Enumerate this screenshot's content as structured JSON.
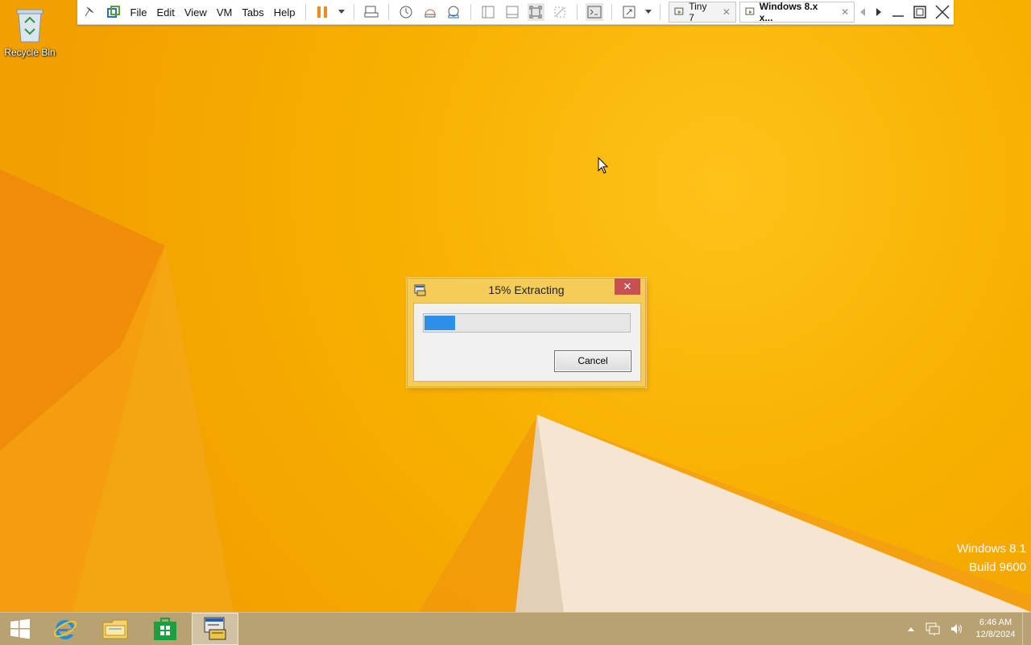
{
  "desktop": {
    "recycle_bin_label": "Recycle Bin",
    "watermark_line1": "Windows 8.1",
    "watermark_line2": "Build 9600"
  },
  "vm_toolbar": {
    "menus": [
      "File",
      "Edit",
      "View",
      "VM",
      "Tabs",
      "Help"
    ],
    "tabs": [
      {
        "label": "Tiny 7",
        "active": false
      },
      {
        "label": "Windows 8.x x...",
        "active": true
      }
    ]
  },
  "dialog": {
    "title": "15% Extracting",
    "progress_fraction": 0.15,
    "cancel_label": "Cancel",
    "close_glyph": "✕"
  },
  "taskbar": {
    "clock_time": "6:46 AM",
    "clock_date": "12/8/2024"
  },
  "colors": {
    "accent": "#2e8fe6",
    "close_red": "#c75050",
    "wallpaper": "#f7b000"
  }
}
